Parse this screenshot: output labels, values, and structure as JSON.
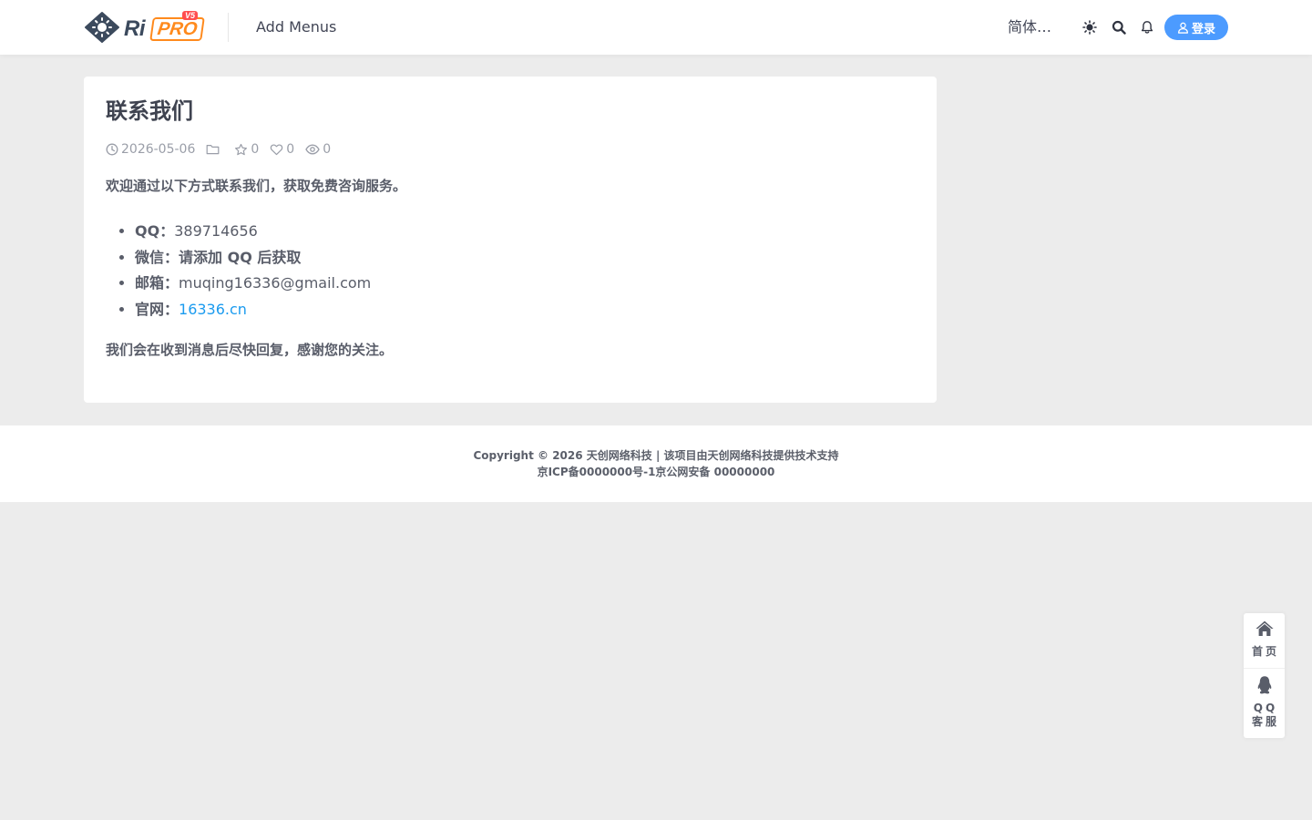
{
  "header": {
    "logo": {
      "text_ri": "Ri",
      "text_pro": "PRO",
      "badge": "V5"
    },
    "nav_items": [
      "Add Menus"
    ],
    "language": "简体…",
    "icons": [
      "theme-toggle-icon",
      "search-icon",
      "bell-icon"
    ],
    "login_label": "登录"
  },
  "article": {
    "title": "联系我们",
    "date": "2026-05-06",
    "favorites": "0",
    "likes": "0",
    "views": "0",
    "intro": "欢迎通过以下方式联系我们，获取免费咨询服务。",
    "contacts": [
      {
        "label": "QQ：",
        "value": "389714656"
      },
      {
        "label": "微信：",
        "value": "请添加 QQ 后获取"
      },
      {
        "label": "邮箱：",
        "value": "muqing16336@gmail.com"
      },
      {
        "label": "官网：",
        "value": "16336.cn"
      }
    ],
    "outro": "我们会在收到消息后尽快回复，感谢您的关注。"
  },
  "footer": {
    "copyright": "Copyright © 2026 天创网络科技 | 该项目由天创网络科技提供技术支持",
    "icp": "京ICP备0000000号-1京公网安备 00000000"
  },
  "float_bar": {
    "home_label": "首页",
    "qq_label_line1": "QQ",
    "qq_label_line2": "客服"
  },
  "colors": {
    "accent": "#4c9bff",
    "link": "#1b9bef",
    "page_bg": "#ececec",
    "brand_orange": "#ff8a1d"
  }
}
